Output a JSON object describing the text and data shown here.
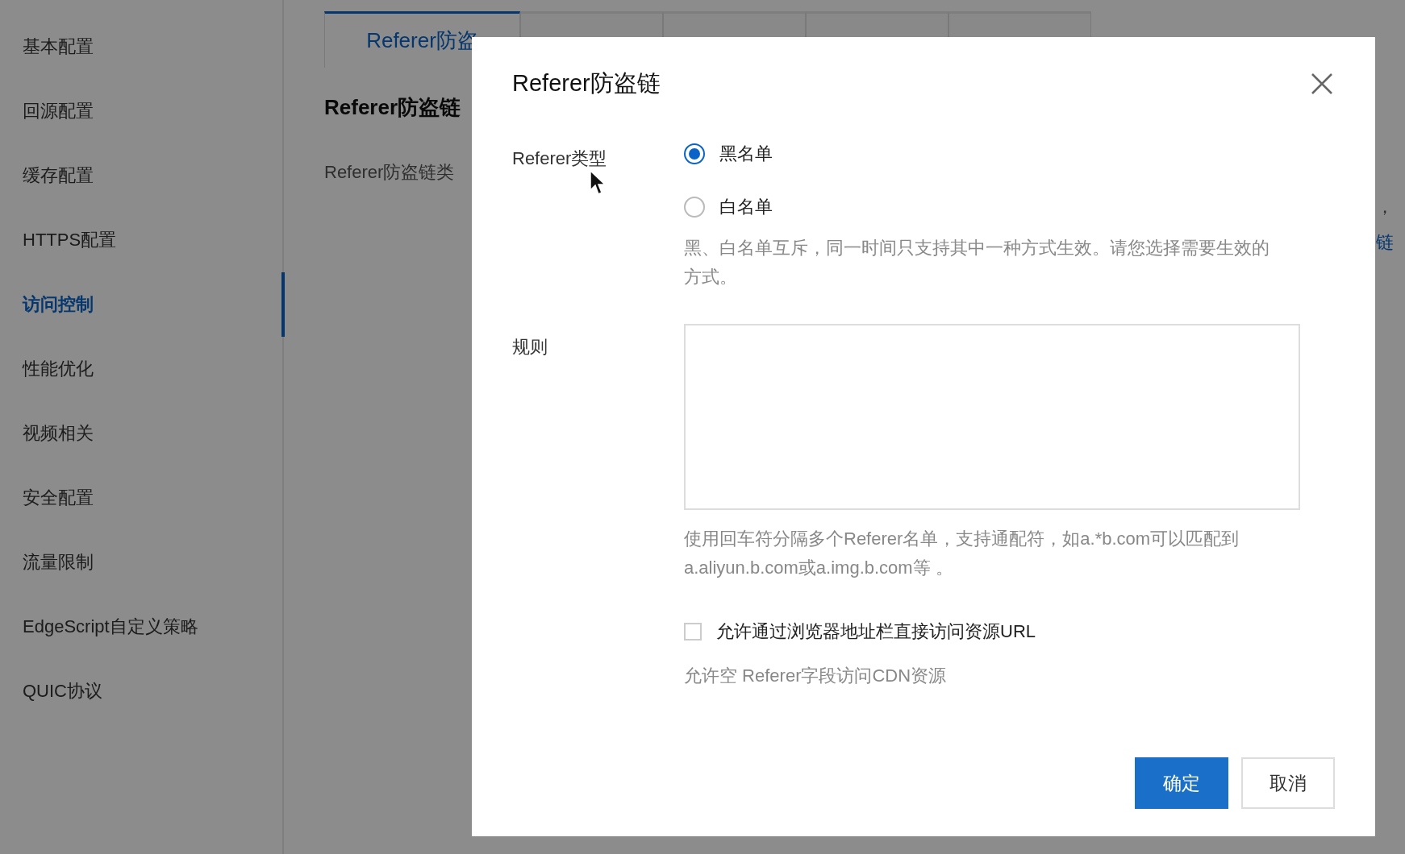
{
  "sidebar": {
    "items": [
      {
        "label": "基本配置",
        "selected": false
      },
      {
        "label": "回源配置",
        "selected": false
      },
      {
        "label": "缓存配置",
        "selected": false
      },
      {
        "label": "HTTPS配置",
        "selected": false
      },
      {
        "label": "访问控制",
        "selected": true
      },
      {
        "label": "性能优化",
        "selected": false
      },
      {
        "label": "视频相关",
        "selected": false
      },
      {
        "label": "安全配置",
        "selected": false
      },
      {
        "label": "流量限制",
        "selected": false
      },
      {
        "label": "EdgeScript自定义策略",
        "selected": false
      },
      {
        "label": "QUIC协议",
        "selected": false
      }
    ]
  },
  "tabs": [
    {
      "label": "Referer防盗",
      "selected": true
    },
    {
      "selected": false
    },
    {
      "selected": false
    },
    {
      "selected": false
    },
    {
      "selected": false
    }
  ],
  "section": {
    "title": "Referer防盗链",
    "text": "Referer防盗链类",
    "right_text": "，",
    "right_link": "链"
  },
  "dialog": {
    "title": "Referer防盗链",
    "type_label": "Referer类型",
    "options": [
      {
        "label": "黑名单",
        "selected": true
      },
      {
        "label": "白名单",
        "selected": false
      }
    ],
    "type_help": "黑、白名单互斥，同一时间只支持其中一种方式生效。请您选择需要生效的方式。",
    "rules_label": "规则",
    "rules_help": "使用回车符分隔多个Referer名单，支持通配符，如a.*b.com可以匹配到a.aliyun.b.com或a.img.b.com等 。",
    "allow_empty": {
      "label": "允许通过浏览器地址栏直接访问资源URL",
      "checked": false
    },
    "allow_empty_help": "允许空 Referer字段访问CDN资源",
    "buttons": [
      {
        "label": "确定",
        "kind": "primary"
      },
      {
        "label": "取消",
        "kind": "secondary"
      }
    ]
  }
}
